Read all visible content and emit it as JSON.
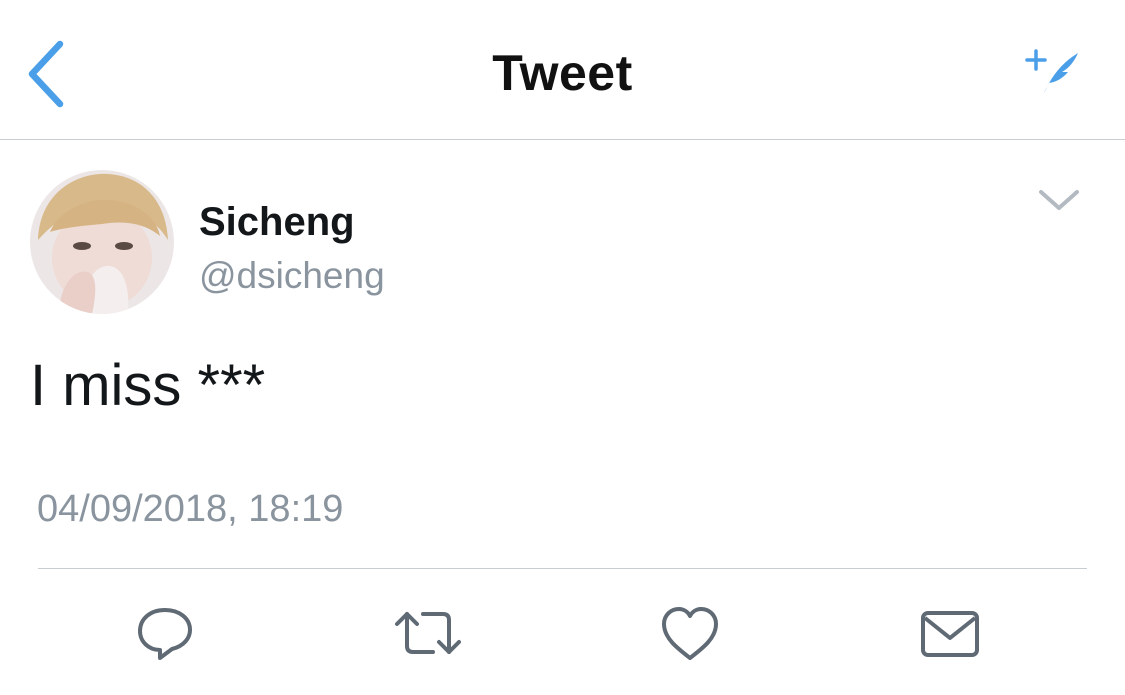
{
  "nav": {
    "title": "Tweet",
    "back_icon": "chevron-left-icon",
    "compose_icon": "compose-tweet-icon",
    "accent_color": "#4a9fe8"
  },
  "tweet": {
    "display_name": "Sicheng",
    "handle": "@dsicheng",
    "text": "I miss ***",
    "timestamp": "04/09/2018, 18:19",
    "menu_icon": "chevron-down-icon"
  },
  "actions": [
    {
      "name": "reply",
      "icon": "reply-bubble-icon"
    },
    {
      "name": "retweet",
      "icon": "retweet-icon"
    },
    {
      "name": "like",
      "icon": "heart-icon"
    },
    {
      "name": "direct-message",
      "icon": "envelope-icon"
    }
  ],
  "colors": {
    "text_primary": "#14171a",
    "text_secondary": "#8a949e",
    "icon_gray": "#5f6a75",
    "divider": "#c8cdd2"
  }
}
